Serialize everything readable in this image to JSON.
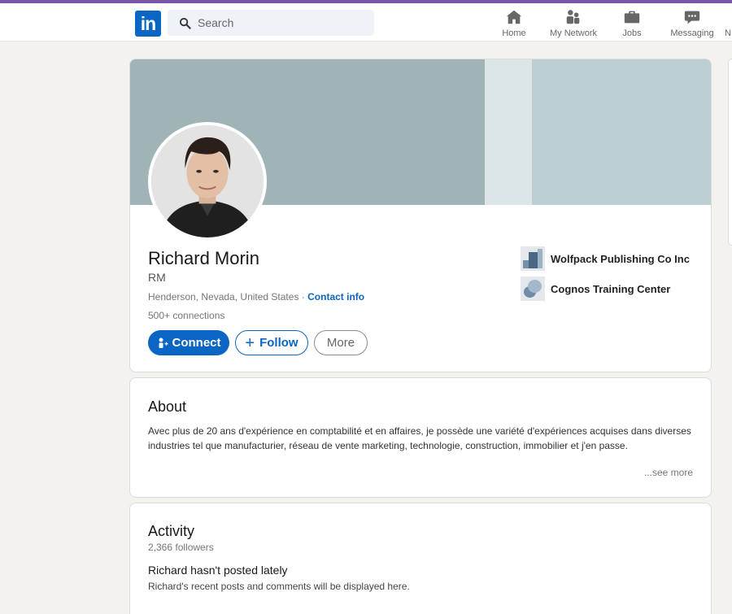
{
  "nav": {
    "logo_text": "in",
    "search_placeholder": "Search",
    "items": [
      {
        "label": "Home",
        "icon": "home-icon"
      },
      {
        "label": "My Network",
        "icon": "network-icon"
      },
      {
        "label": "Jobs",
        "icon": "briefcase-icon"
      },
      {
        "label": "Messaging",
        "icon": "chat-icon"
      },
      {
        "label": "N",
        "icon": "notifications-icon"
      }
    ]
  },
  "profile": {
    "name": "Richard Morin",
    "headline": "RM",
    "location": "Henderson, Nevada, United States",
    "separator": " · ",
    "contact_info": "Contact info",
    "connections": "500+ connections",
    "buttons": {
      "connect": "Connect",
      "follow": "Follow",
      "more": "More"
    },
    "experience": [
      {
        "company": "Wolfpack Publishing Co Inc",
        "icon": "company-logo"
      },
      {
        "company": "Cognos Training Center",
        "icon": "school-logo"
      }
    ]
  },
  "about": {
    "title": "About",
    "text": "Avec plus de 20 ans d'expérience en comptabilité et en affaires, je possède une variété d'expériences acquises dans diverses industries tel que manufacturier, réseau de vente marketing, technologie, construction, immobilier et j'en passe.",
    "see_more": "...see more"
  },
  "activity": {
    "title": "Activity",
    "followers": "2,366 followers",
    "heading": "Richard hasn't posted lately",
    "sub": "Richard's recent posts and comments will be displayed here."
  },
  "colors": {
    "brand": "#0a66c2",
    "cover": "#a0b4b7",
    "page_bg": "#f3f2ef"
  }
}
